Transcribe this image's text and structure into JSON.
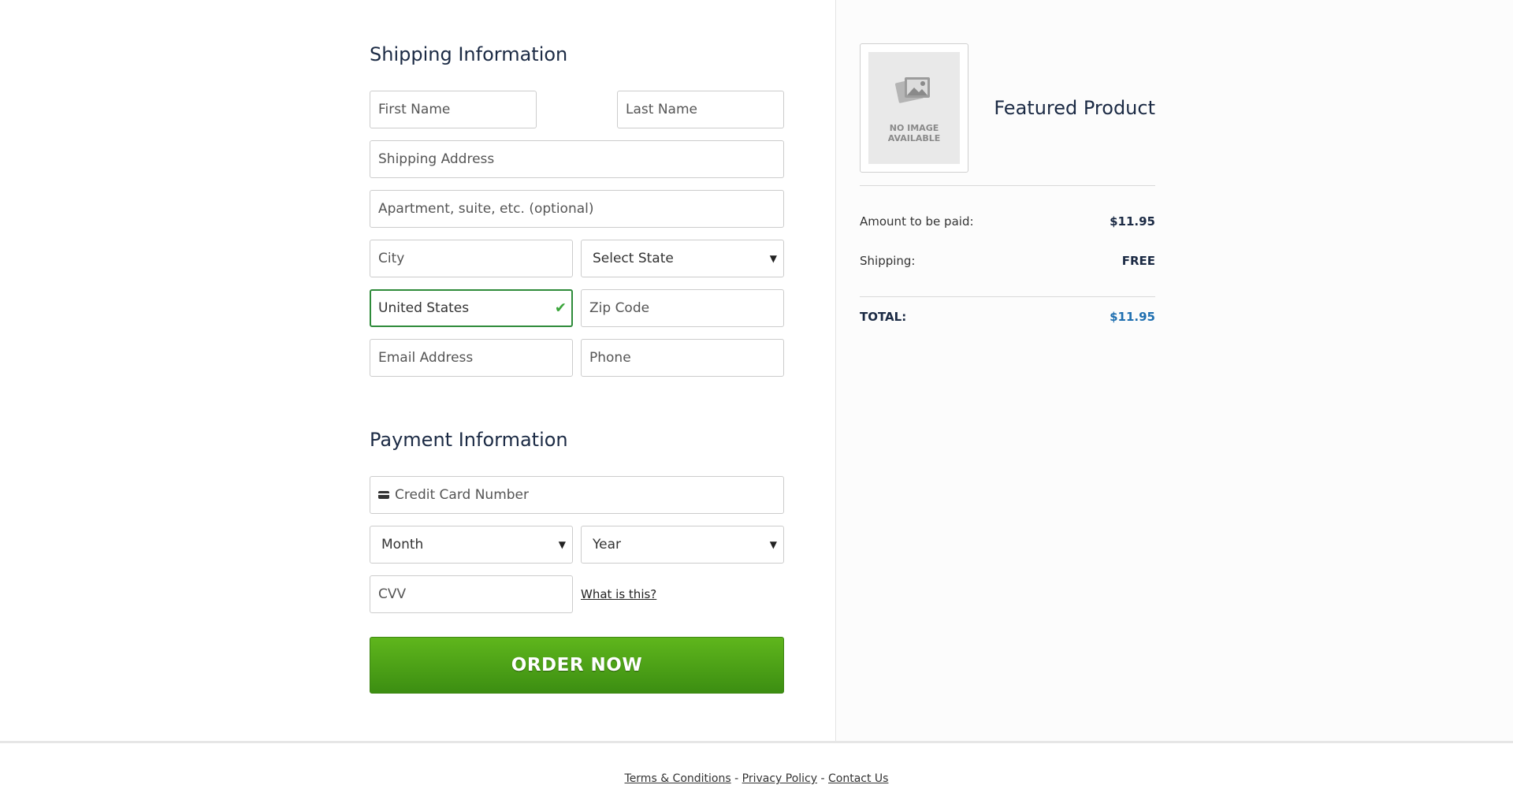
{
  "shipping": {
    "title": "Shipping Information",
    "first_name_placeholder": "First Name",
    "last_name_placeholder": "Last Name",
    "address_placeholder": "Shipping Address",
    "apartment_placeholder": "Apartment, suite, etc. (optional)",
    "city_placeholder": "City",
    "state_selected": "Select State",
    "country_value": "United States",
    "zip_placeholder": "Zip Code",
    "email_placeholder": "Email Address",
    "phone_placeholder": "Phone"
  },
  "payment": {
    "title": "Payment Information",
    "card_placeholder": "Credit Card Number",
    "month_selected": "Month",
    "year_selected": "Year",
    "cvv_placeholder": "CVV",
    "what_is_this": "What is this?",
    "order_button": "ORDER NOW"
  },
  "summary": {
    "product_title": "Featured Product",
    "no_image_text_line1": "NO IMAGE",
    "no_image_text_line2": "AVAILABLE",
    "amount_label": "Amount to be paid:",
    "amount_value": "$11.95",
    "shipping_label": "Shipping:",
    "shipping_value": "FREE",
    "total_label": "TOTAL:",
    "total_value": "$11.95"
  },
  "footer": {
    "terms": "Terms & Conditions",
    "separator": " - ",
    "privacy": "Privacy Policy",
    "contact": "Contact Us"
  },
  "colors": {
    "accent_green": "#5fb61c",
    "valid_border": "#2e8b3a",
    "total_blue": "#1f6fb0",
    "heading_navy": "#1b2a44"
  },
  "icons": {
    "valid": "checkmark-icon",
    "card": "credit-card-icon",
    "dropdown": "chevron-down-icon",
    "no_image": "image-placeholder-icon"
  }
}
